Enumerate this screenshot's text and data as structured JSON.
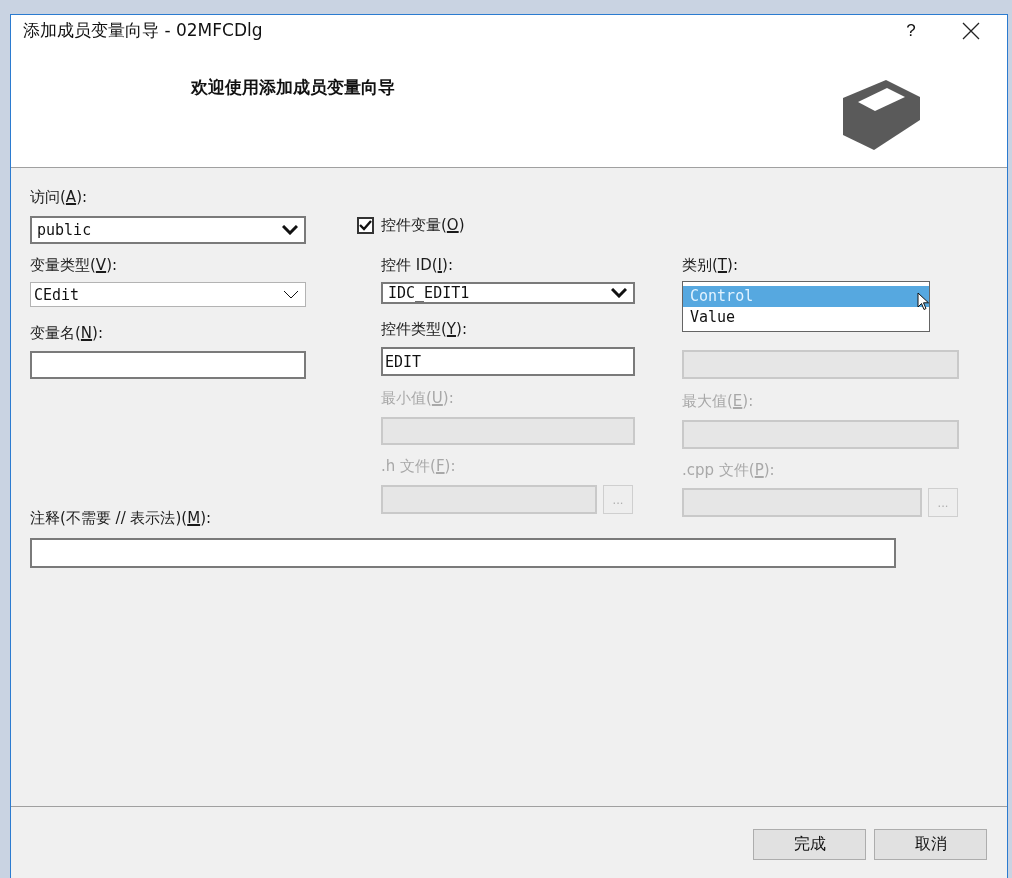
{
  "window": {
    "title": "添加成员变量向导 - 02MFCDlg",
    "help": "?"
  },
  "header": {
    "heading": "欢迎使用添加成员变量向导"
  },
  "access": {
    "label": {
      "before": "访问(",
      "key": "A",
      "after": "):"
    },
    "value": "public",
    "kind": "droplist"
  },
  "variable_type": {
    "label": {
      "before": "变量类型(",
      "key": "V",
      "after": "):"
    },
    "value": "CEdit",
    "kind": "editable"
  },
  "variable_name": {
    "label": {
      "before": "变量名(",
      "key": "N",
      "after": "):"
    },
    "disabled": false
  },
  "control_variable": {
    "label": {
      "before": "控件变量(",
      "key": "O",
      "after": ")"
    },
    "checked": true
  },
  "control_id": {
    "label": {
      "before": "控件 ID(",
      "key": "I",
      "after": "):"
    },
    "value": "IDC_EDIT1",
    "kind": "droplist"
  },
  "control_type": {
    "label": {
      "before": "控件类型(",
      "key": "Y",
      "after": "):"
    },
    "value": "EDIT",
    "disabled": false
  },
  "min_value": {
    "label": {
      "before": "最小值(",
      "key": "U",
      "after": "):"
    },
    "disabled": true
  },
  "h_file": {
    "label": {
      "before": ".h 文件(",
      "key": "F",
      "after": "):"
    },
    "disabled": true,
    "browse": "..."
  },
  "category": {
    "label": {
      "before": "类别(",
      "key": "T",
      "after": "):"
    },
    "expanded": true,
    "options": [
      {
        "label": "Control",
        "selected": true
      },
      {
        "label": "Value",
        "selected": false
      }
    ]
  },
  "max_chars": {
    "disabled": true
  },
  "max_value": {
    "label": {
      "before": "最大值(",
      "key": "E",
      "after": "):"
    },
    "disabled": true
  },
  "cpp_file": {
    "label": {
      "before": ".cpp 文件(",
      "key": "P",
      "after": "):"
    },
    "disabled": true,
    "browse": "..."
  },
  "comment": {
    "label": {
      "before": "注释(不需要 // 表示法)(",
      "key": "M",
      "after": "):"
    },
    "disabled": false
  },
  "buttons": [
    {
      "label": "完成"
    },
    {
      "label": "取消"
    }
  ]
}
